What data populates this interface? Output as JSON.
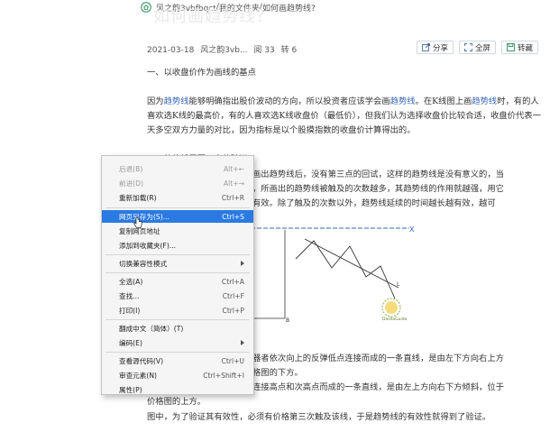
{
  "breadcrumb": {
    "parts": [
      "风之韵3vbfbqct",
      "我的文件夹",
      "如何画趋势线?"
    ],
    "sep": " / "
  },
  "page_title_ghost": "如何画趋势线？",
  "meta": {
    "date": "2021-03-18",
    "author": "风之韵3vb...",
    "reads": "阅 33",
    "reposts": "转 6"
  },
  "actions": {
    "share": "分享",
    "fullscreen": "全屏",
    "transfer": "转藏"
  },
  "article": {
    "heading1": "一、以收盘价作为画线的基点",
    "para1_parts": [
      "因为",
      "趋势线",
      "能够明确指出股价波动的方向，所以投资者应该学会画",
      "趋势线",
      "。在K线图上画",
      "趋势线",
      "时，有的人喜欢选K线的最高价，有的人喜欢选K线收盘价（最低价），但我们认为选择收盘价比较合适，收盘价代表一天多空双方力量的对比，因为指标是以个股摸指数的收盘价计算得出的。"
    ],
    "heading2_partial": "二、趋势线需要三点的验证",
    "right_lines": [
      "画出趋势线后，没有第三点的回试，这样的趋势线是没有意义的，当",
      "，所画出的趋势线被触及的次数越多，其趋势线的作用就越强，用它",
      "有效。除了触及的次数以外，趋势线延续的时间越长越有效，越可"
    ],
    "lower_lines": [
      "器者依次向上的反弹低点连接而成的一条直线，是由左下方向右上方",
      "格图的下方。",
      "连接高点和次高点而成的一条直线，是由左上方向右下方倾斜，位于",
      "价格图的上方。",
      "图中，为了验证其有效性，必须有价格第三次触及该线，于是趋势线的有效性就得到了验证。"
    ]
  },
  "figure": {
    "x_label": "X",
    "b_label": "B",
    "l_label": "L",
    "stamp_text": "DashaGuide"
  },
  "context_menu": {
    "items": [
      {
        "label": "后退(B)",
        "shortcut": "Alt+←",
        "state": "disabled"
      },
      {
        "label": "前进(D)",
        "shortcut": "Alt+→",
        "state": "disabled"
      },
      {
        "label": "重新加载(R)",
        "shortcut": "Ctrl+R",
        "state": "normal"
      },
      {
        "label": "网页另存为(S)...",
        "shortcut": "Ctrl+S",
        "state": "hot"
      },
      {
        "label": "复制网页地址",
        "shortcut": "",
        "state": "normal"
      },
      {
        "label": "添加到收藏夹(F)...",
        "shortcut": "",
        "state": "normal"
      },
      {
        "label": "切换兼容性模式",
        "shortcut": "",
        "state": "submenu"
      },
      {
        "label": "全选(A)",
        "shortcut": "Ctrl+A",
        "state": "normal"
      },
      {
        "label": "查找...",
        "shortcut": "Ctrl+F",
        "state": "normal"
      },
      {
        "label": "打印(I)",
        "shortcut": "Ctrl+P",
        "state": "normal"
      },
      {
        "label": "翻成中文（简体）(T)",
        "shortcut": "",
        "state": "normal"
      },
      {
        "label": "编码(E)",
        "shortcut": "",
        "state": "submenu"
      },
      {
        "label": "查看源代码(V)",
        "shortcut": "Ctrl+U",
        "state": "normal"
      },
      {
        "label": "审查元素(N)",
        "shortcut": "Ctrl+Shift+I",
        "state": "normal"
      },
      {
        "label": "属性(P)",
        "shortcut": "",
        "state": "normal"
      }
    ]
  },
  "colors": {
    "link": "#3a67b8",
    "menu_highlight": "#2a7ae2"
  }
}
